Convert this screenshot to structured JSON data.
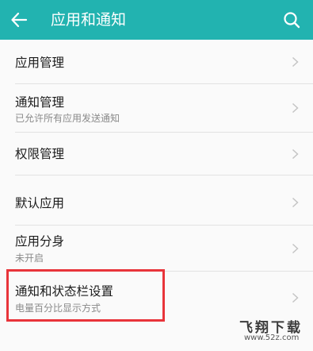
{
  "header": {
    "title": "应用和通知",
    "bar_color": "#22b3b0",
    "back_icon": "arrow-left-icon",
    "search_icon": "search-icon"
  },
  "items": [
    {
      "label": "应用管理",
      "sub": ""
    },
    {
      "label": "通知管理",
      "sub": "已允许所有应用发送通知"
    },
    {
      "label": "权限管理",
      "sub": ""
    },
    {
      "label": "默认应用",
      "sub": ""
    },
    {
      "label": "应用分身",
      "sub": "未开启"
    },
    {
      "label": "通知和状态栏设置",
      "sub": "电量百分比显示方式"
    }
  ],
  "highlight_color": "#e8343a",
  "watermark": {
    "brand": "飞翔下载",
    "url": "www.52z.com"
  }
}
